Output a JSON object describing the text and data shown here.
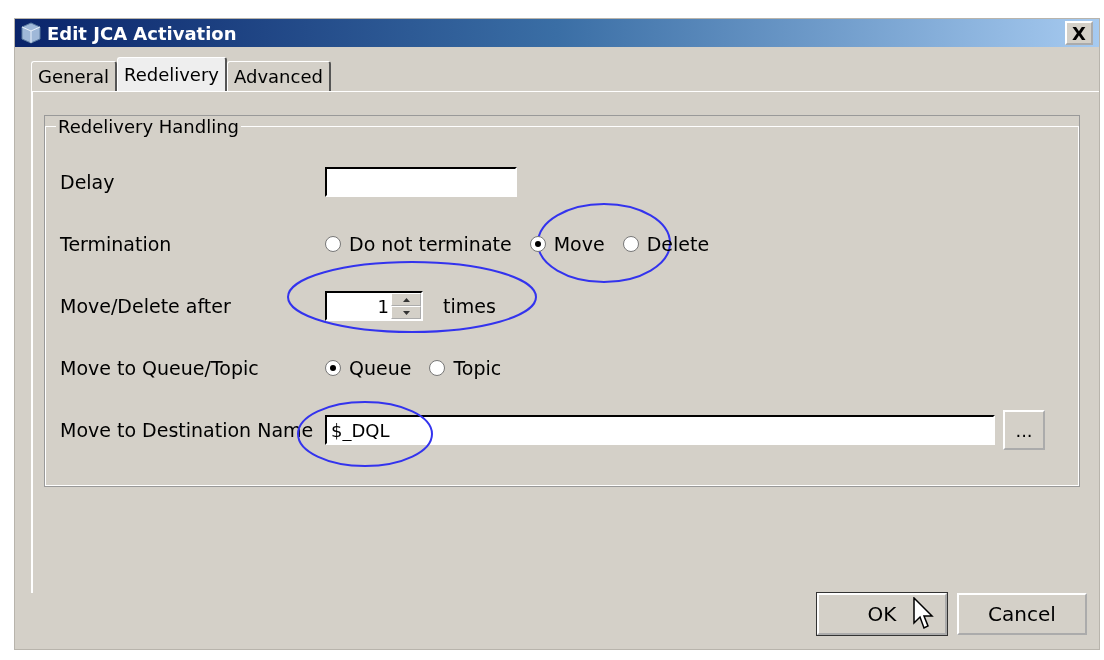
{
  "window": {
    "title": "Edit JCA Activation",
    "close": "X"
  },
  "tabs": [
    {
      "label": "General",
      "selected": false
    },
    {
      "label": "Redelivery",
      "selected": true
    },
    {
      "label": "Advanced",
      "selected": false
    }
  ],
  "group": {
    "title": "Redelivery Handling",
    "delay": {
      "label": "Delay"
    },
    "termination": {
      "label": "Termination",
      "options": [
        {
          "label": "Do not terminate",
          "selected": false
        },
        {
          "label": "Move",
          "selected": true
        },
        {
          "label": "Delete",
          "selected": false
        }
      ]
    },
    "move_after": {
      "label": "Move/Delete after",
      "value": "1",
      "unit": "times"
    },
    "queue_topic": {
      "label": "Move to Queue/Topic",
      "options": [
        {
          "label": "Queue",
          "selected": true
        },
        {
          "label": "Topic",
          "selected": false
        }
      ]
    },
    "destination": {
      "label": "Move to Destination Name",
      "value": "$_DQL",
      "browse": "..."
    }
  },
  "buttons": [
    {
      "label": "OK",
      "default": true
    },
    {
      "label": "Cancel",
      "default": false
    }
  ]
}
